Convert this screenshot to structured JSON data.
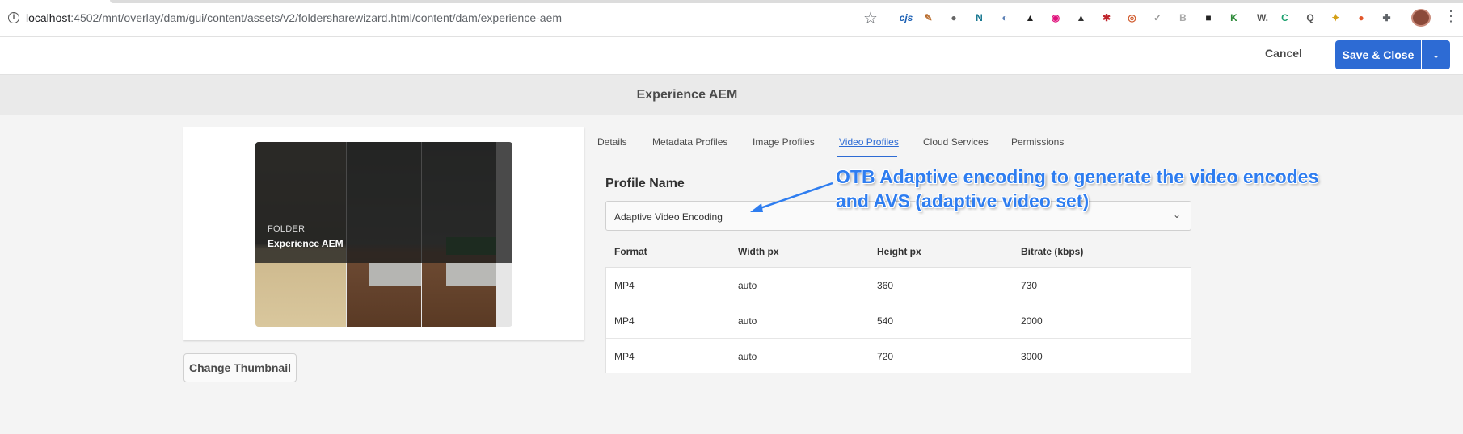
{
  "browser": {
    "url_host": "localhost",
    "url_path": ":4502/mnt/overlay/dam/gui/content/assets/v2/foldersharewizard.html/content/dam/experience-aem",
    "extensions": [
      {
        "name": "cjs-icon",
        "glyph": "cjs",
        "color": "#1a5fb4"
      },
      {
        "name": "pen-icon",
        "glyph": "✎",
        "color": "#b86b2b"
      },
      {
        "name": "circle-icon",
        "glyph": "●",
        "color": "#666666"
      },
      {
        "name": "n-icon",
        "glyph": "N",
        "color": "#1c7a93"
      },
      {
        "name": "ghost-icon",
        "glyph": "◐",
        "color": "#5b7fb5"
      },
      {
        "name": "grad-cap-icon",
        "glyph": "▲",
        "color": "#222222"
      },
      {
        "name": "record-icon",
        "glyph": "◉",
        "color": "#e0117c"
      },
      {
        "name": "drive-icon",
        "glyph": "▲",
        "color": "#333333"
      },
      {
        "name": "red-square-icon",
        "glyph": "✱",
        "color": "#c0262d"
      },
      {
        "name": "target-icon",
        "glyph": "◎",
        "color": "#d0592b"
      },
      {
        "name": "check-icon",
        "glyph": "✓",
        "color": "#999999"
      },
      {
        "name": "bi-icon",
        "glyph": "B",
        "color": "#aaaaaa"
      },
      {
        "name": "monster-icon",
        "glyph": "■",
        "color": "#222222"
      },
      {
        "name": "leaf-icon",
        "glyph": "K",
        "color": "#2e8b3a"
      },
      {
        "name": "w-icon",
        "glyph": "W.",
        "color": "#555555"
      },
      {
        "name": "green-c-icon",
        "glyph": "C",
        "color": "#1aa06d"
      },
      {
        "name": "magnify-icon",
        "glyph": "Q",
        "color": "#555555"
      },
      {
        "name": "bulb-icon",
        "glyph": "✦",
        "color": "#d4a017"
      },
      {
        "name": "duck-icon",
        "glyph": "●",
        "color": "#e2572b"
      },
      {
        "name": "puzzle-icon",
        "glyph": "✚",
        "color": "#5f6368"
      }
    ]
  },
  "actions": {
    "cancel": "Cancel",
    "save": "Save & Close"
  },
  "page": {
    "title": "Experience AEM"
  },
  "folder": {
    "kind": "FOLDER",
    "name": "Experience AEM",
    "change_thumbnail": "Change Thumbnail"
  },
  "tabs": [
    "Details",
    "Metadata Profiles",
    "Image Profiles",
    "Video Profiles",
    "Cloud Services",
    "Permissions"
  ],
  "active_tab": "Video Profiles",
  "profile": {
    "label": "Profile Name",
    "value": "Adaptive Video Encoding"
  },
  "table": {
    "headers": [
      "Format",
      "Width px",
      "Height px",
      "Bitrate (kbps)"
    ],
    "rows": [
      [
        "MP4",
        "auto",
        "360",
        "730"
      ],
      [
        "MP4",
        "auto",
        "540",
        "2000"
      ],
      [
        "MP4",
        "auto",
        "720",
        "3000"
      ]
    ]
  },
  "annotation": {
    "line1": "OTB Adaptive encoding to generate the video encodes",
    "line2": "and AVS (adaptive video set)"
  },
  "colors": {
    "accent": "#2d6bd4",
    "annotation": "#2e7df0"
  }
}
